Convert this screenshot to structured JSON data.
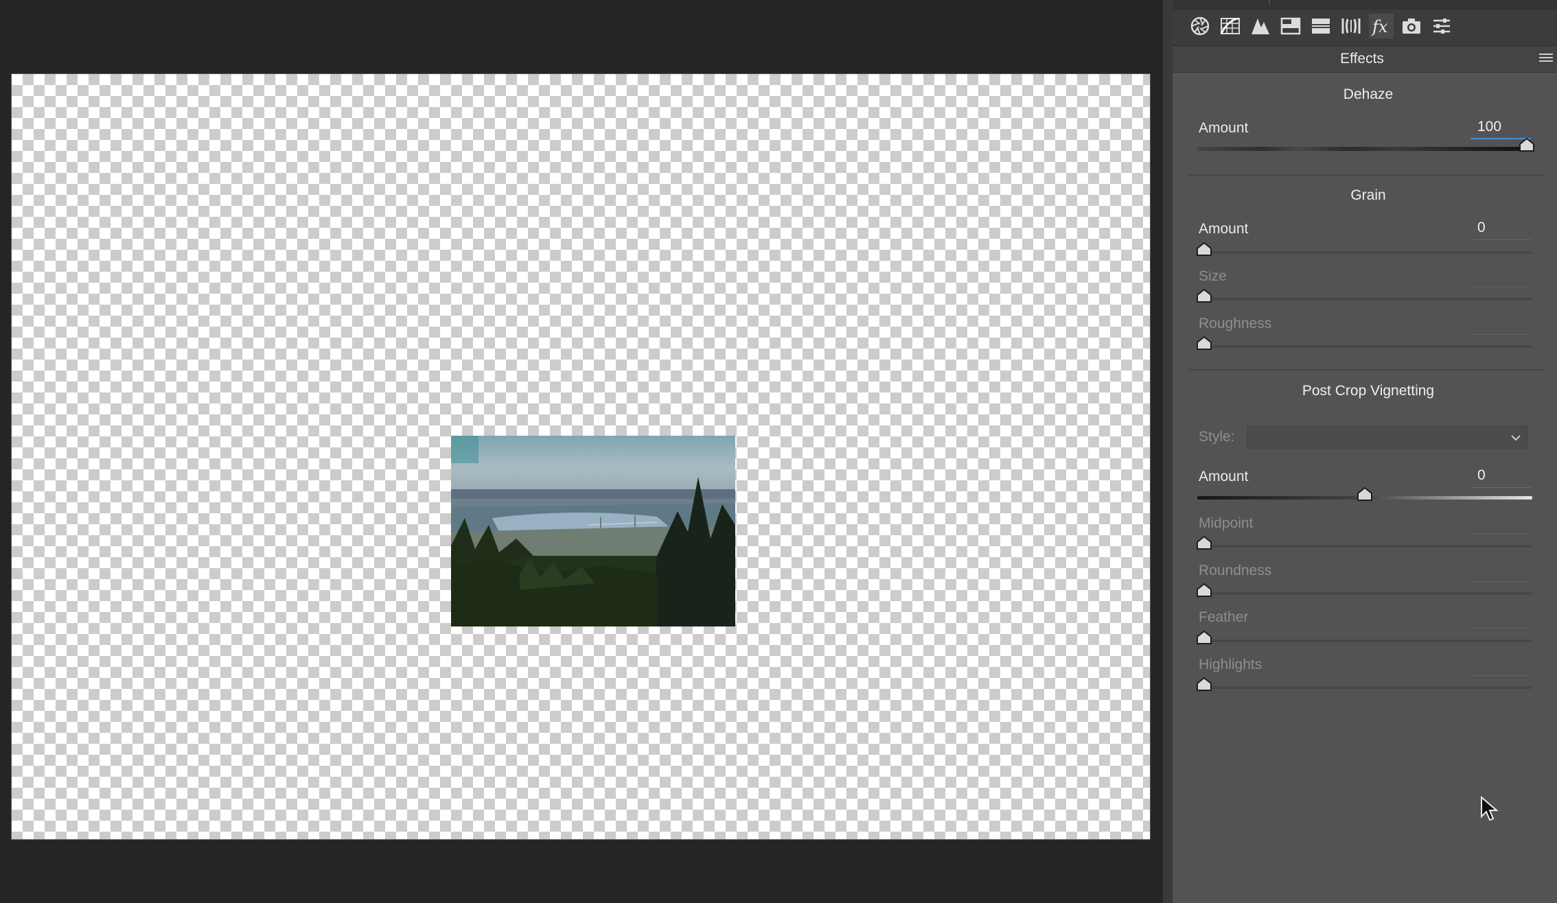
{
  "panel": {
    "title": "Effects",
    "toolbar_icons": [
      "basic-aperture-icon",
      "tone-curve-icon",
      "detail-icon",
      "hsl-icon",
      "split-toning-icon",
      "lens-corrections-icon",
      "fx-icon",
      "camera-calibration-icon",
      "presets-icon"
    ],
    "active_tab": "fx-icon"
  },
  "dehaze": {
    "title": "Dehaze",
    "amount": {
      "label": "Amount",
      "value": "100",
      "fraction": 1.0
    }
  },
  "grain": {
    "title": "Grain",
    "amount": {
      "label": "Amount",
      "value": "0",
      "fraction": 0.0
    },
    "size": {
      "label": "Size",
      "value": "",
      "fraction": 0.0
    },
    "roughness": {
      "label": "Roughness",
      "value": "",
      "fraction": 0.0
    }
  },
  "vignette": {
    "title": "Post Crop Vignetting",
    "style": {
      "label": "Style:",
      "value": ""
    },
    "amount": {
      "label": "Amount",
      "value": "0",
      "fraction": 0.5
    },
    "midpoint": {
      "label": "Midpoint",
      "value": "",
      "fraction": 0.0
    },
    "roundness": {
      "label": "Roundness",
      "value": "",
      "fraction": 0.0
    },
    "feather": {
      "label": "Feather",
      "value": "",
      "fraction": 0.0
    },
    "highlights": {
      "label": "Highlights",
      "value": "",
      "fraction": 0.0
    }
  },
  "colors": {
    "panel_bg": "#535353",
    "canvas_bg": "#252525",
    "focus_accent": "#4a8fd6"
  }
}
